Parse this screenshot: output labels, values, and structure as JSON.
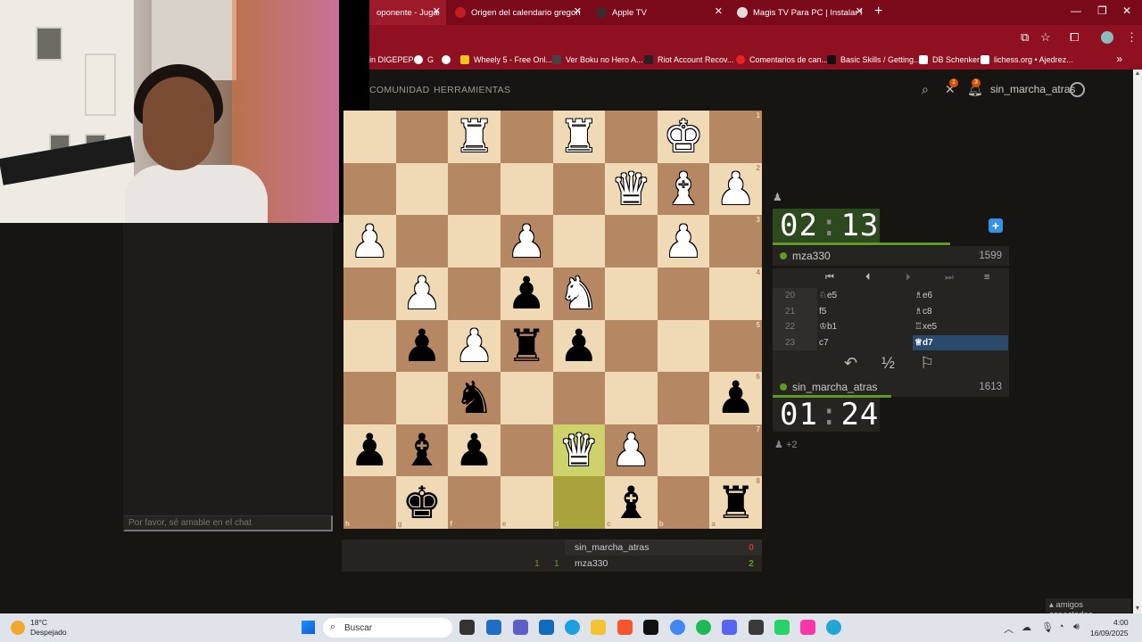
{
  "browser": {
    "tabs": [
      {
        "label": "oponente - Jugar",
        "active": true
      },
      {
        "label": "Origen del calendario gregorian",
        "active": false
      },
      {
        "label": "Apple TV",
        "active": false
      },
      {
        "label": "Magis TV Para PC | Instalar Mag",
        "active": false
      }
    ],
    "new_tab": "+",
    "bookmarks": [
      "in DIGEPEP",
      "G",
      "",
      "Wheely 5 - Free Onl...",
      "Ver Boku no Hero A...",
      "Riot Account Recov...",
      "Comentarios de can...",
      "Basic Skills / Getting...",
      "DB Schenker",
      "lichess.org • Ajedrez..."
    ]
  },
  "header": {
    "nav": [
      "COMUNIDAD",
      "HERRAMIENTAS"
    ],
    "username": "sin_marcha_atras",
    "challenge_badge": "1",
    "notif_badge": "3"
  },
  "chat": {
    "placeholder": "Por favor, sé amable en el chat"
  },
  "board": {
    "orientation": "black",
    "ranks": [
      "1",
      "2",
      "3",
      "4",
      "5",
      "6",
      "7",
      "8"
    ],
    "files": [
      "h",
      "g",
      "f",
      "e",
      "d",
      "c",
      "b",
      "a"
    ],
    "highlight": [
      "d7",
      "d8"
    ]
  },
  "clocks": {
    "opponent": {
      "min": "02",
      "sec": "13",
      "running": true,
      "remaining_fraction": 0.75
    },
    "self": {
      "min": "01",
      "sec": "24",
      "running": false,
      "remaining_fraction": 0.5
    }
  },
  "players": {
    "opponent": {
      "name": "mza330",
      "rating": "1599"
    },
    "self": {
      "name": "sin_marcha_atras",
      "rating": "1613"
    }
  },
  "moves": [
    {
      "num": "20",
      "white": "♘e5",
      "black": "♗e6"
    },
    {
      "num": "21",
      "white": "f5",
      "black": "♗c8"
    },
    {
      "num": "22",
      "white": "♔b1",
      "black": "♖xe5"
    },
    {
      "num": "23",
      "white": "c7",
      "black": "♕d7"
    }
  ],
  "actions": {
    "takeback": "↶",
    "draw": "½",
    "resign": "⚐"
  },
  "pocket": {
    "text": "+2"
  },
  "crosstable": {
    "rows": [
      {
        "name": "sin_marcha_atras",
        "cells": [
          "",
          ""
        ],
        "score": "0",
        "score_color": "#cc3333"
      },
      {
        "name": "mza330",
        "cells": [
          "1",
          "1"
        ],
        "score": "2",
        "score_color": "#629924"
      }
    ]
  },
  "friends": {
    "label": "amigos conectados"
  },
  "taskbar": {
    "weather_temp": "18°C",
    "weather_desc": "Despejado",
    "search_placeholder": "Buscar",
    "time": "4:00",
    "date": "16/09/2025"
  }
}
